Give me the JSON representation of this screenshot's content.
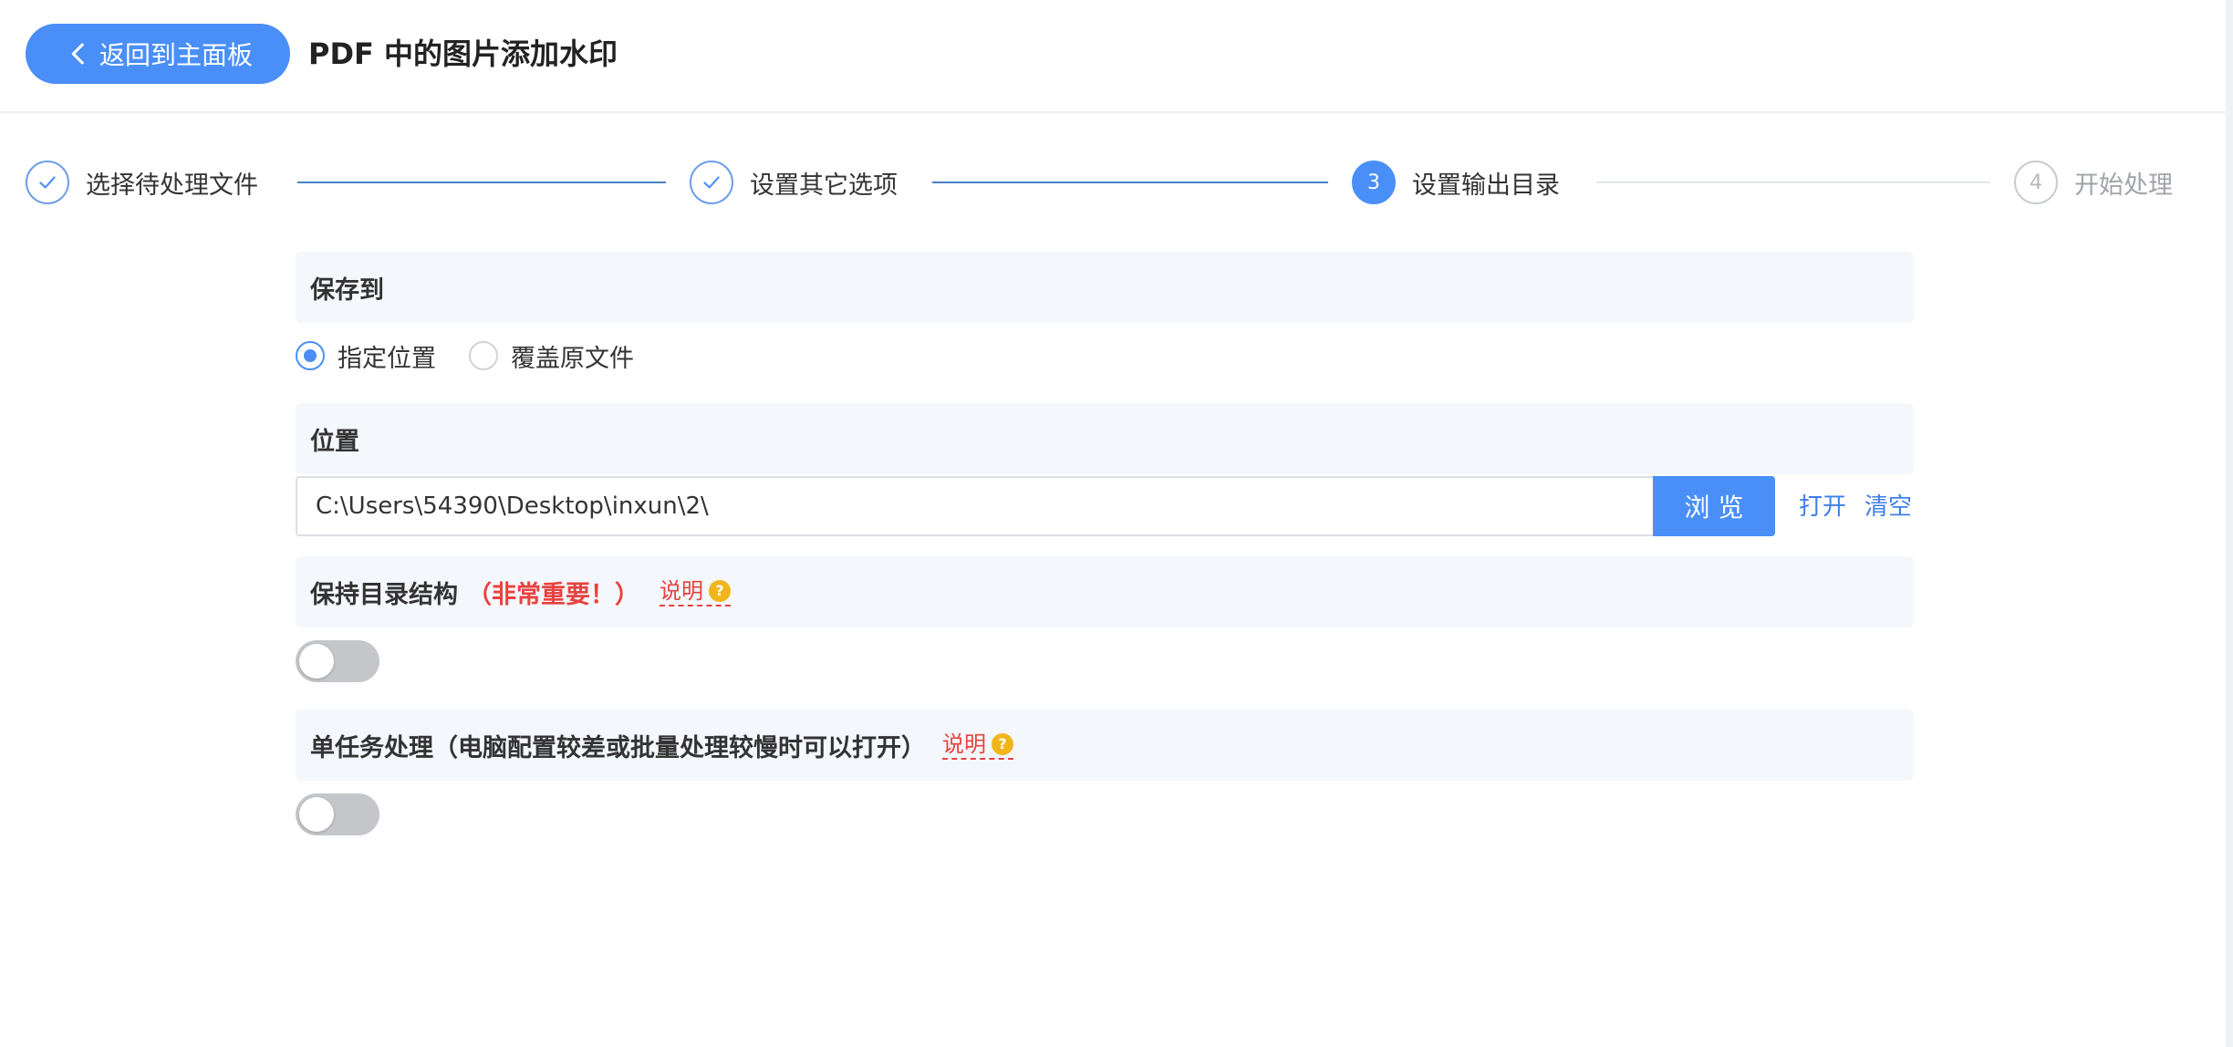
{
  "header": {
    "back_label": "返回到主面板",
    "title": "PDF 中的图片添加水印"
  },
  "steps": [
    {
      "label": "选择待处理文件",
      "status": "done",
      "icon": "check-icon"
    },
    {
      "label": "设置其它选项",
      "status": "done",
      "icon": "check-icon"
    },
    {
      "label": "设置输出目录",
      "status": "active",
      "number": "3"
    },
    {
      "label": "开始处理",
      "status": "todo",
      "number": "4"
    }
  ],
  "save_to": {
    "title": "保存到",
    "options": [
      {
        "label": "指定位置",
        "checked": true
      },
      {
        "label": "覆盖原文件",
        "checked": false
      }
    ]
  },
  "location": {
    "title": "位置",
    "path": "C:\\Users\\54390\\Desktop\\inxun\\2\\",
    "browse_label": "浏 览",
    "open_label": "打开",
    "clear_label": "清空"
  },
  "keep_structure": {
    "title": "保持目录结构",
    "warning": "（非常重要！）",
    "explain_label": "说明",
    "enabled": false
  },
  "single_task": {
    "title": "单任务处理（电脑配置较差或批量处理较慢时可以打开）",
    "explain_label": "说明",
    "enabled": false
  },
  "colors": {
    "accent": "#4a8ff7",
    "warning": "#e8423f",
    "help_icon": "#f1b51c"
  }
}
